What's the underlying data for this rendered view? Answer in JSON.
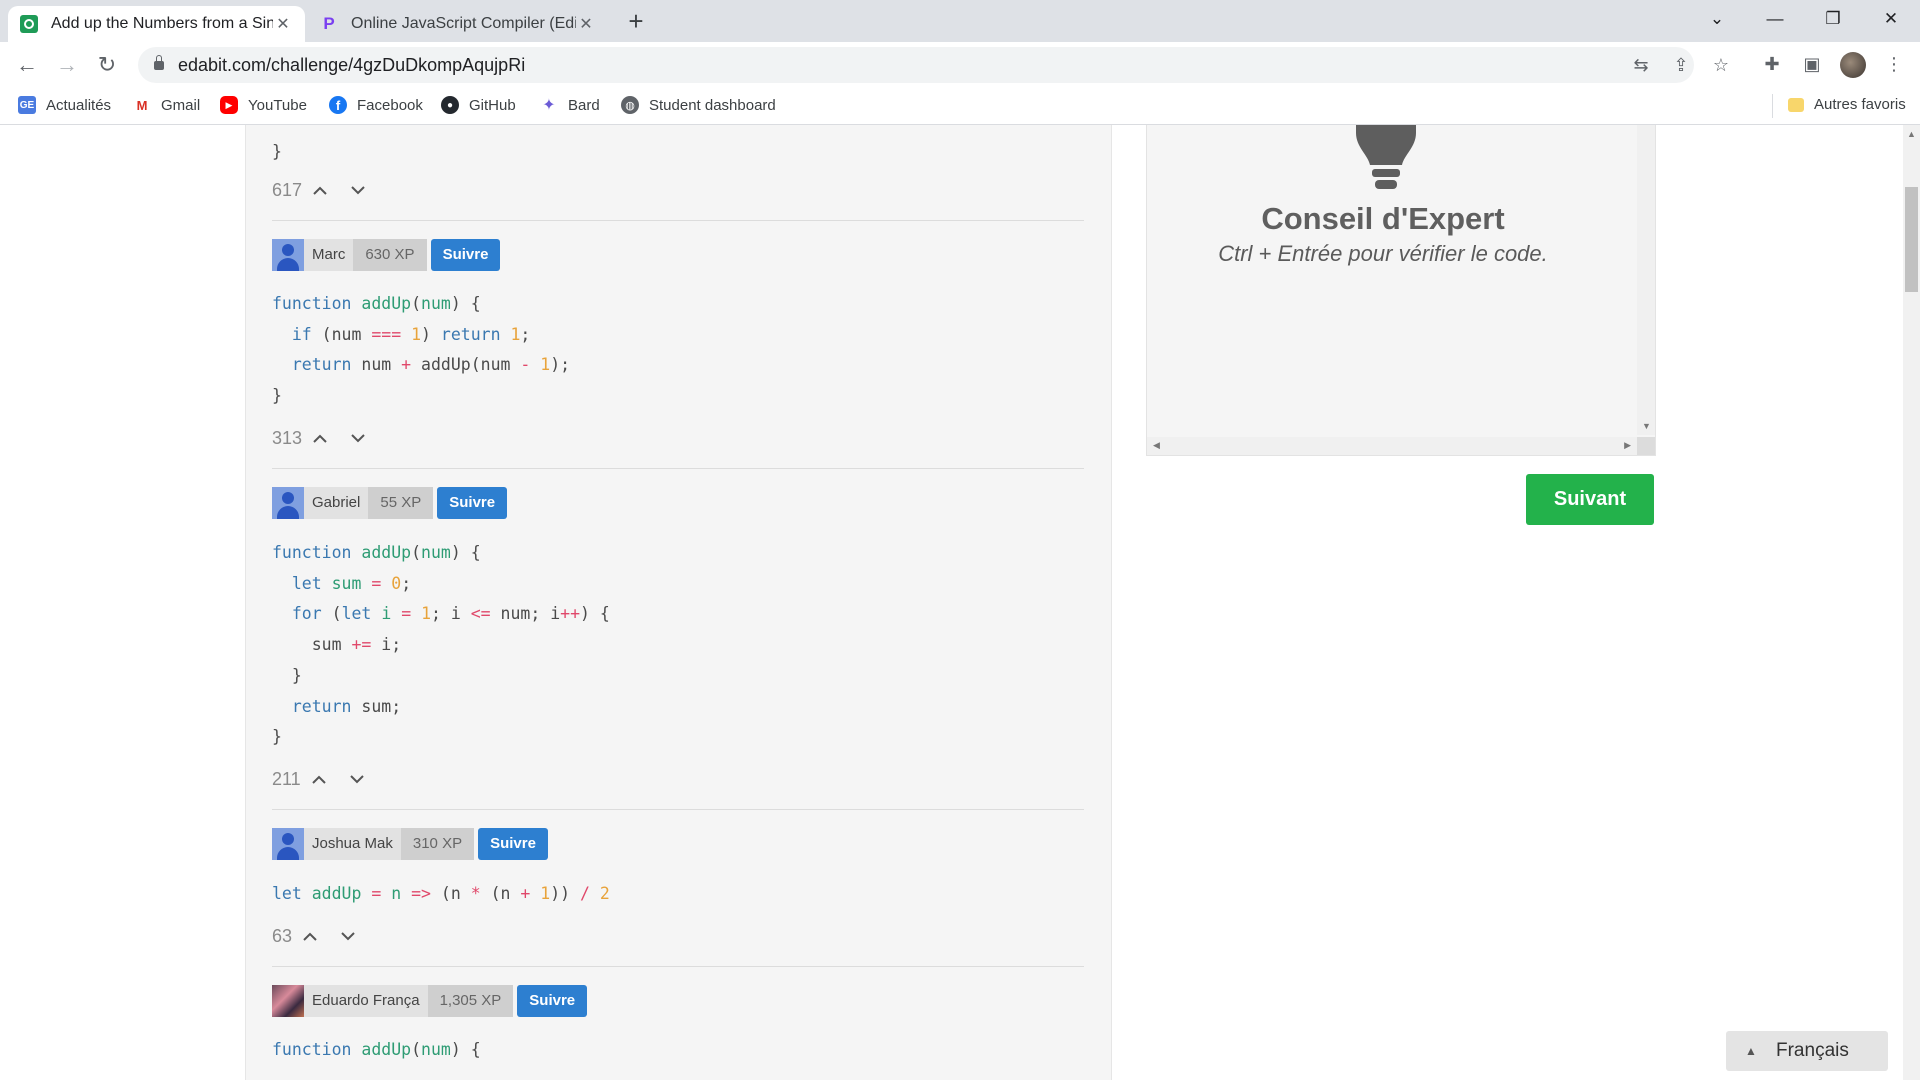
{
  "browser": {
    "tabs": [
      {
        "title": "Add up the Numbers from a Single",
        "active": true
      },
      {
        "title": "Online JavaScript Compiler (Editor)",
        "active": false
      }
    ],
    "new_tab": "+",
    "url": "edabit.com/challenge/4gzDuDkompAqujpRi",
    "bookmarks": [
      "Actualités",
      "Gmail",
      "YouTube",
      "Facebook",
      "GitHub",
      "Bard",
      "Student dashboard"
    ],
    "other_bookmarks": "Autres favoris",
    "icons": [
      "back-arrow-icon",
      "forward-arrow-icon",
      "reload-icon",
      "lock-icon",
      "translate-icon",
      "share-icon",
      "star-icon",
      "extensions-icon",
      "side-panel-icon",
      "profile-avatar"
    ]
  },
  "solutions": [
    {
      "closing_brace": "}",
      "votes": "617"
    },
    {
      "user": "Marc",
      "xp": "630 XP",
      "follow": "Suivre",
      "code": [
        "function addUp(num) {",
        "  if (num === 1) return 1;",
        "  return num + addUp(num - 1);",
        "}"
      ],
      "votes": "313"
    },
    {
      "user": "Gabriel",
      "xp": "55 XP",
      "follow": "Suivre",
      "code": [
        "function addUp(num) {",
        "  let sum = 0;",
        "  for (let i = 1; i <= num; i++) {",
        "    sum += i;",
        "  }",
        "  return sum;",
        "}"
      ],
      "votes": "211"
    },
    {
      "user": "Joshua Mak",
      "xp": "310 XP",
      "follow": "Suivre",
      "code": [
        "let addUp = n => (n * (n + 1)) / 2"
      ],
      "votes": "63"
    },
    {
      "user": "Eduardo França",
      "xp": "1,305 XP",
      "follow": "Suivre",
      "code": [
        "function addUp(num) {"
      ]
    }
  ],
  "tip": {
    "title": "Conseil d'Expert",
    "text": "Ctrl + Entrée pour vérifier le code."
  },
  "next_button": "Suivant",
  "language": "Français",
  "colors": {
    "keyword": "#3a78b0",
    "function": "#2e9c74",
    "number": "#e8a33b",
    "operator": "#e0486a",
    "follow": "#2d7fd0",
    "next": "#23b24b"
  }
}
